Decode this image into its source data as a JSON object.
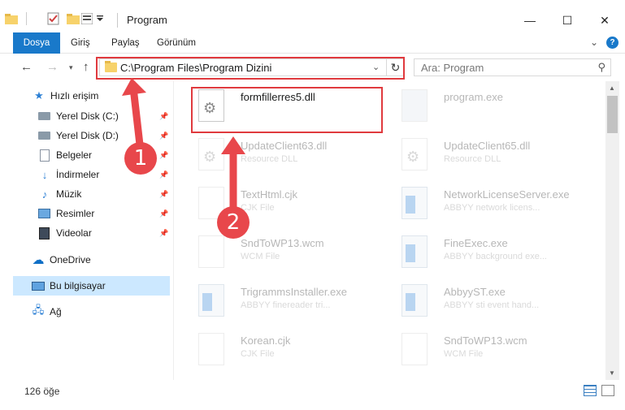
{
  "window": {
    "title": "Program",
    "minimize": "—",
    "maximize": "☐",
    "close": "✕"
  },
  "ribbon": {
    "tabs": [
      "Dosya",
      "Giriş",
      "Paylaş",
      "Görünüm"
    ],
    "expand": "⌄",
    "help": "?"
  },
  "nav": {
    "back": "←",
    "forward": "→",
    "recent": "▾",
    "up": "↑"
  },
  "address": {
    "path": "C:\\Program Files\\Program Dizini",
    "dropdown": "⌄",
    "refresh": "↻"
  },
  "search": {
    "placeholder": "Ara: Program",
    "icon": "⚲"
  },
  "sidebar": {
    "items": [
      {
        "label": "Hızlı erişim",
        "icon": "star-icon",
        "pinned": false
      },
      {
        "label": "Yerel Disk (C:)",
        "icon": "disk-icon",
        "pinned": true
      },
      {
        "label": "Yerel Disk (D:)",
        "icon": "disk-icon",
        "pinned": true
      },
      {
        "label": "Belgeler",
        "icon": "document-icon",
        "pinned": true
      },
      {
        "label": "İndirmeler",
        "icon": "download-icon",
        "pinned": true
      },
      {
        "label": "Müzik",
        "icon": "music-icon",
        "pinned": true
      },
      {
        "label": "Resimler",
        "icon": "picture-icon",
        "pinned": true
      },
      {
        "label": "Videolar",
        "icon": "video-icon",
        "pinned": true
      },
      {
        "label": "OneDrive",
        "icon": "cloud-icon",
        "pinned": false
      },
      {
        "label": "Bu bilgisayar",
        "icon": "computer-icon",
        "pinned": false,
        "selected": true
      },
      {
        "label": "Ağ",
        "icon": "network-icon",
        "pinned": false
      }
    ],
    "pin_glyph": "📌"
  },
  "files": [
    {
      "name": "formfillerres5.dll",
      "desc": "",
      "icon": "gear-file-icon",
      "highlight": true
    },
    {
      "name": "program.exe",
      "desc": "",
      "icon": "exe-icon"
    },
    {
      "name": "UpdateClient63.dll",
      "desc": "Resource DLL",
      "icon": "gear-file-icon"
    },
    {
      "name": "UpdateClient65.dll",
      "desc": "Resource DLL",
      "icon": "gear-file-icon"
    },
    {
      "name": "TextHtml.cjk",
      "desc": "CJK File",
      "icon": "blank-file-icon"
    },
    {
      "name": "NetworkLicenseServer.exe",
      "desc": "ABBYY network licens...",
      "icon": "app-icon"
    },
    {
      "name": "SndToWP13.wcm",
      "desc": "WCM File",
      "icon": "blank-file-icon"
    },
    {
      "name": "FineExec.exe",
      "desc": "ABBYY background exe...",
      "icon": "app-icon"
    },
    {
      "name": "TrigrammsInstaller.exe",
      "desc": "ABBYY finereader tri...",
      "icon": "app-icon"
    },
    {
      "name": "AbbyyST.exe",
      "desc": "ABBYY sti event hand...",
      "icon": "app-icon"
    },
    {
      "name": "Korean.cjk",
      "desc": "CJK File",
      "icon": "blank-file-icon"
    },
    {
      "name": "SndToWP13.wcm",
      "desc": "WCM File",
      "icon": "blank-file-icon"
    }
  ],
  "status": {
    "count": "126 öğe"
  },
  "annotations": {
    "step1": "1",
    "step2": "2",
    "color": "#e03a3e"
  },
  "colors": {
    "accent": "#1979ca",
    "selection": "#cce8ff"
  }
}
